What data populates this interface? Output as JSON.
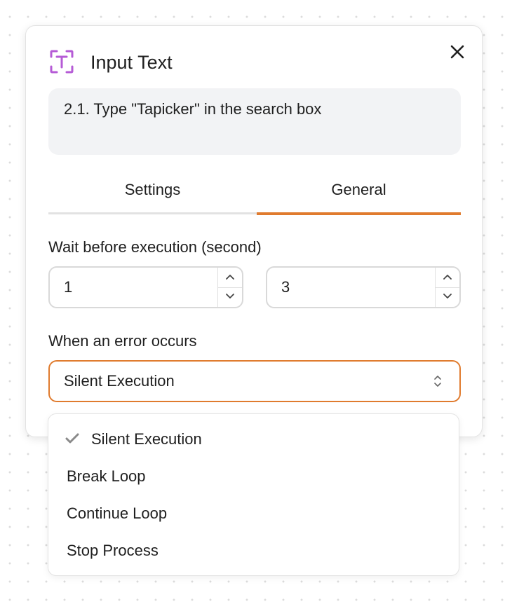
{
  "colors": {
    "accent": "#e07b2e",
    "icon": "#b55bd6"
  },
  "header": {
    "icon": "text-cursor-icon",
    "title": "Input Text",
    "close_icon": "close-icon"
  },
  "step_description": "2.1. Type \"Tapicker\" in the search box",
  "tabs": [
    {
      "label": "Settings",
      "active": false
    },
    {
      "label": "General",
      "active": true
    }
  ],
  "wait": {
    "label": "Wait before execution (second)",
    "min": "1",
    "max": "3"
  },
  "error": {
    "label": "When an error occurs",
    "selected": "Silent Execution",
    "options": [
      "Silent Execution",
      "Break Loop",
      "Continue Loop",
      "Stop Process"
    ]
  }
}
